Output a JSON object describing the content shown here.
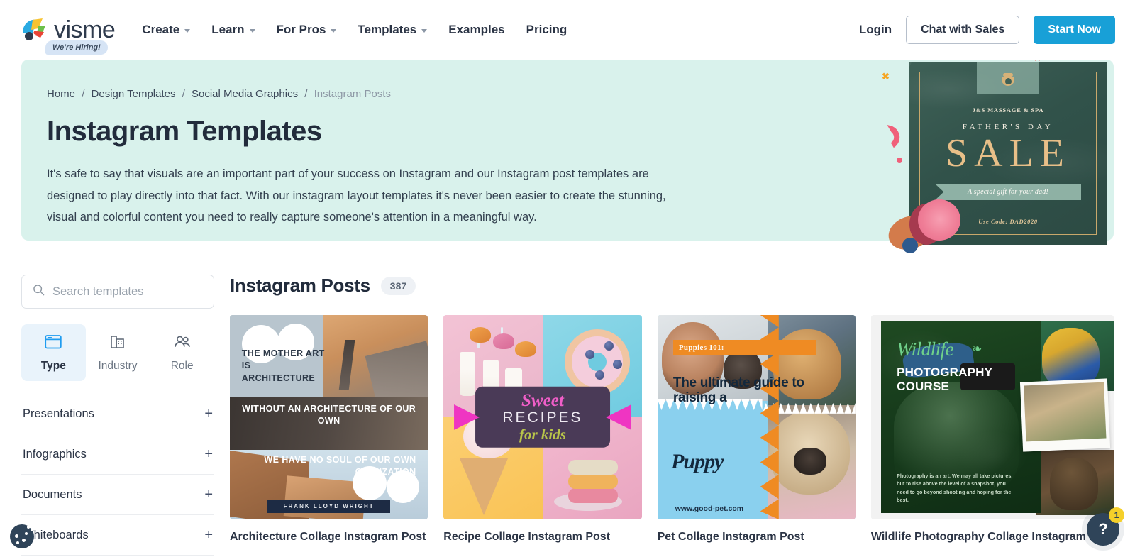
{
  "header": {
    "logo_text": "visme",
    "hiring_badge": "We're Hiring!",
    "nav": [
      {
        "label": "Create",
        "has_caret": true
      },
      {
        "label": "Learn",
        "has_caret": true
      },
      {
        "label": "For Pros",
        "has_caret": true
      },
      {
        "label": "Templates",
        "has_caret": true
      },
      {
        "label": "Examples",
        "has_caret": false
      },
      {
        "label": "Pricing",
        "has_caret": false
      }
    ],
    "login_label": "Login",
    "chat_label": "Chat with Sales",
    "start_label": "Start Now",
    "primary_color": "#18a0d7"
  },
  "hero": {
    "background_color": "#d9f2ec",
    "breadcrumb": [
      {
        "label": "Home",
        "current": false
      },
      {
        "label": "Design Templates",
        "current": false
      },
      {
        "label": "Social Media Graphics",
        "current": false
      },
      {
        "label": "Instagram Posts",
        "current": true
      }
    ],
    "title": "Instagram Templates",
    "description": "It's safe to say that visuals are an important part of your success on Instagram and our Instagram post templates are designed to play directly into that fact. With our instagram layout templates it's never been easier to create the stunning, visual and colorful content you need to really capture someone's attention in a meaningful way.",
    "artwork": {
      "brand": "J&S MASSAGE & SPA",
      "eyebrow": "FATHER'S DAY",
      "headline": "SALE",
      "ribbon": "A special gift for your dad!",
      "code": "Use Code: DAD2020"
    }
  },
  "sidebar": {
    "search": {
      "placeholder": "Search templates",
      "value": "",
      "icon": "search-icon"
    },
    "tabs": [
      {
        "label": "Type",
        "icon": "window-icon",
        "active": true
      },
      {
        "label": "Industry",
        "icon": "buildings-icon",
        "active": false
      },
      {
        "label": "Role",
        "icon": "people-icon",
        "active": false
      }
    ],
    "categories": [
      {
        "label": "Presentations",
        "expander": "+"
      },
      {
        "label": "Infographics",
        "expander": "+"
      },
      {
        "label": "Documents",
        "expander": "+"
      },
      {
        "label": "Whiteboards",
        "expander": "+"
      }
    ]
  },
  "main": {
    "title": "Instagram Posts",
    "count": "387",
    "cards": [
      {
        "title": "Architecture Collage Instagram Post",
        "thumb": {
          "line1": "THE MOTHER ART IS ARCHITECTURE",
          "line2": "WITHOUT AN ARCHITECTURE OF OUR OWN",
          "line3": "WE HAVE NO SOUL OF OUR OWN CIVILIZATION",
          "signature": "FRANK LLOYD WRIGHT"
        }
      },
      {
        "title": "Recipe Collage Instagram Post",
        "thumb": {
          "word1": "Sweet",
          "word2": "RECIPES",
          "word3": "for kids"
        }
      },
      {
        "title": "Pet Collage Instagram Post",
        "thumb": {
          "tag": "Puppies 101:",
          "headline": "The ultimate guide to raising a",
          "script": "Puppy",
          "url": "www.good-pet.com"
        }
      },
      {
        "title": "Wildlife Photography Collage Instagram Post",
        "thumb": {
          "script": "Wildlife",
          "subtitle": "PHOTOGRAPHY COURSE",
          "body": "Photography is an art. We may all take pictures, but to rise above the level of a snapshot, you need to go beyond shooting and hoping for the best."
        }
      }
    ]
  },
  "floating": {
    "cookie_icon": "cookie-icon",
    "help_label": "?",
    "help_badge": "1"
  }
}
